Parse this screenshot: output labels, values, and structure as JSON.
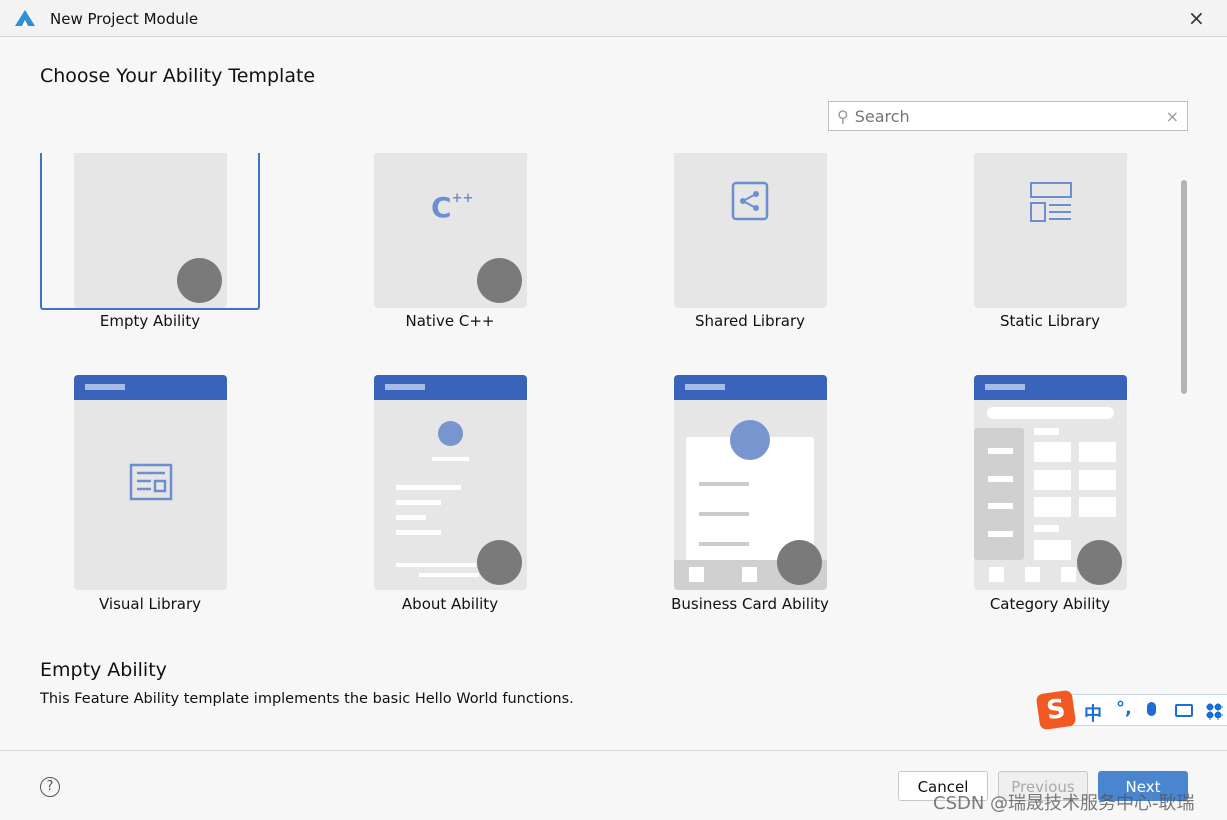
{
  "window": {
    "title": "New Project Module",
    "close": "×"
  },
  "heading": "Choose Your Ability Template",
  "search": {
    "placeholder": "Search",
    "value": "",
    "clear": "×"
  },
  "templates": [
    {
      "label": "Empty Ability",
      "selected": true
    },
    {
      "label": "Native C++"
    },
    {
      "label": "Shared Library"
    },
    {
      "label": "Static Library"
    },
    {
      "label": "Visual Library"
    },
    {
      "label": "About Ability"
    },
    {
      "label": "Business Card Ability"
    },
    {
      "label": "Category Ability"
    }
  ],
  "description": {
    "title": "Empty Ability",
    "text": "This Feature Ability template implements the basic Hello World functions."
  },
  "footer": {
    "help": "?",
    "cancel": "Cancel",
    "previous": "Previous",
    "next": "Next"
  },
  "ime": {
    "mode": "中",
    "punct": "°,"
  },
  "watermark": "CSDN @瑞晟技术服务中心-耿瑞",
  "colors": {
    "accent": "#3d74c9",
    "header": "#3a63bb",
    "next": "#4a86cf"
  }
}
